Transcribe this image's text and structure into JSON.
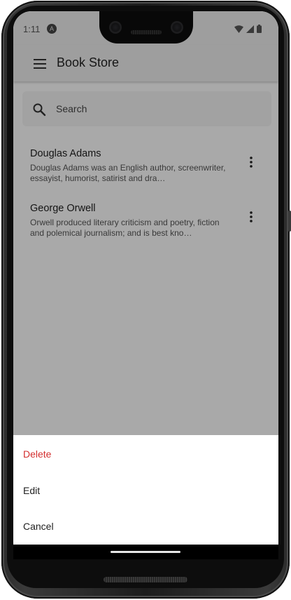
{
  "status_bar": {
    "time": "1:11",
    "app_icon": "A"
  },
  "app_bar": {
    "title": "Book Store",
    "menu_icon": "menu-icon"
  },
  "search": {
    "placeholder": "Search",
    "icon": "search-icon"
  },
  "authors": [
    {
      "name": "Douglas Adams",
      "description": "Douglas Adams was an English author, screenwriter, essayist, humorist, satirist and dra…"
    },
    {
      "name": "George Orwell",
      "description": "Orwell produced literary criticism and poetry, fiction and polemical journalism; and is best kno…"
    }
  ],
  "bottom_sheet": {
    "delete_label": "Delete",
    "edit_label": "Edit",
    "cancel_label": "Cancel"
  },
  "colors": {
    "delete": "#d32f2f",
    "app_bar": "#e9e9e9",
    "scrim": "rgba(0,0,0,0.32)"
  }
}
